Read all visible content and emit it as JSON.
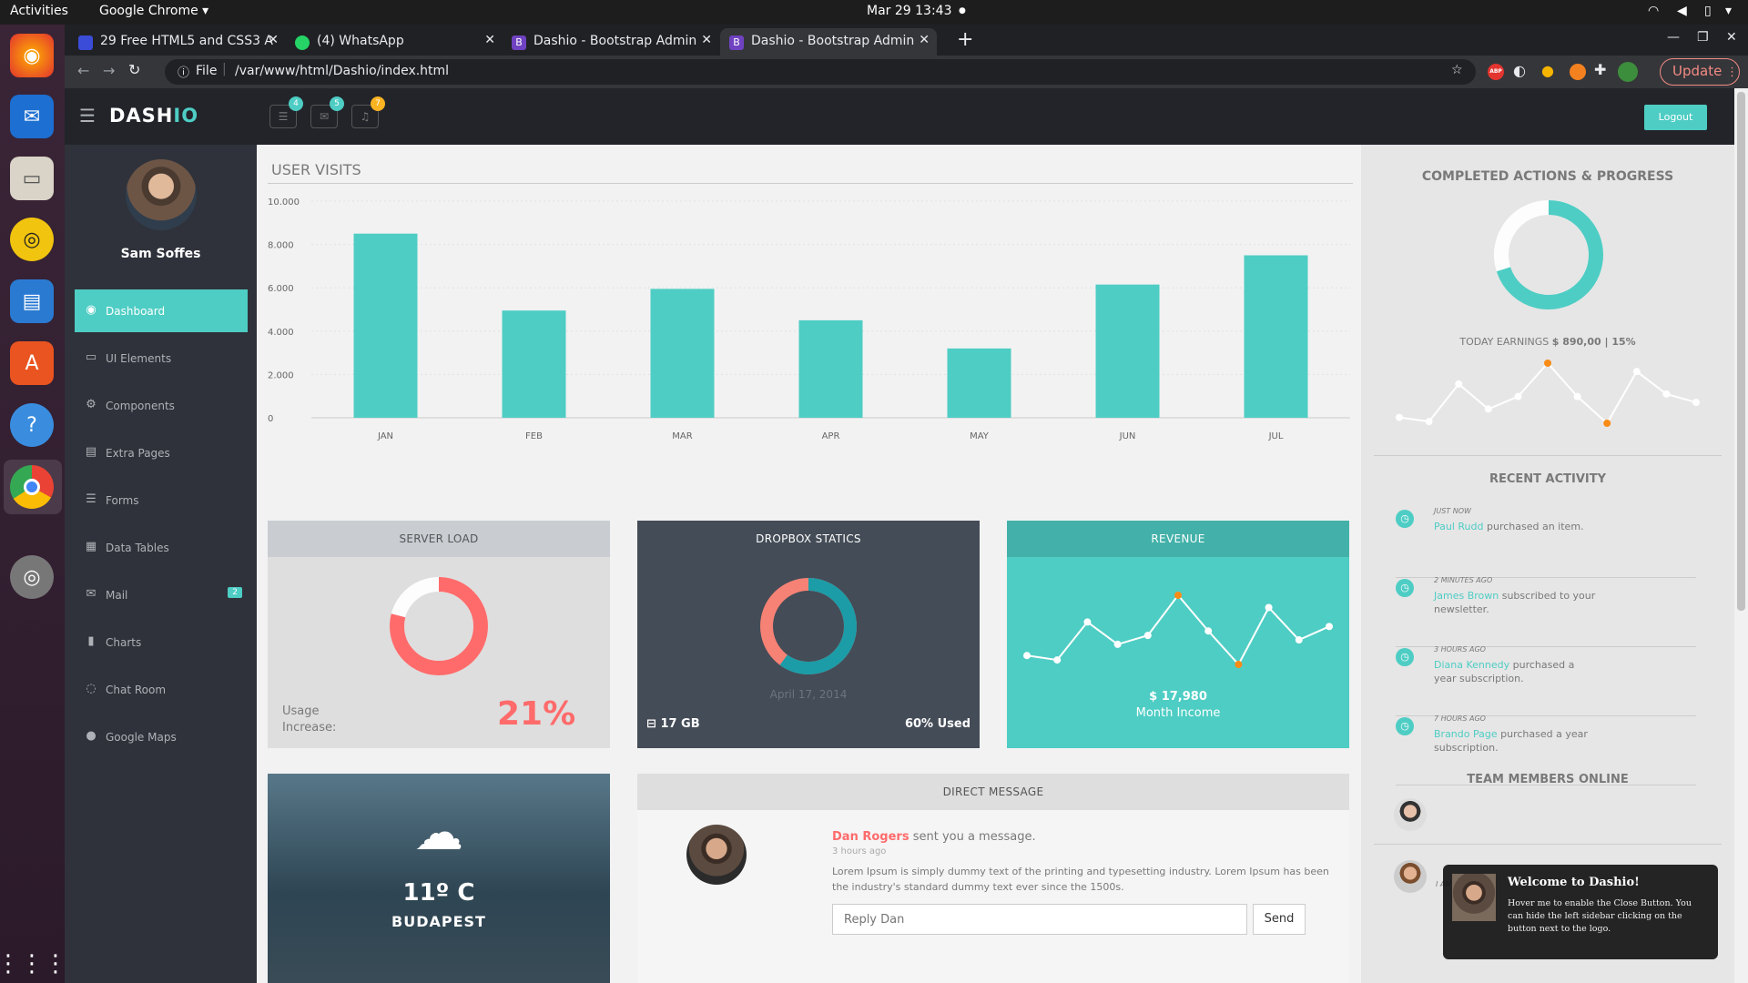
{
  "os": {
    "activities": "Activities",
    "app_menu": "Google Chrome",
    "clock": "Mar 29  13:43"
  },
  "browser": {
    "tabs": [
      {
        "title": "29 Free HTML5 and CSS3 A",
        "color": "#3b4cd9"
      },
      {
        "title": "(4) WhatsApp",
        "color": "#25d366"
      },
      {
        "title": "Dashio - Bootstrap Admin",
        "color": "#6f42c1"
      },
      {
        "title": "Dashio - Bootstrap Admin",
        "color": "#6f42c1"
      }
    ],
    "url_scheme": "File",
    "url": "/var/www/html/Dashio/index.html",
    "update_label": "Update",
    "abp_label": "ABP"
  },
  "app": {
    "logo_a": "DASH",
    "logo_b": "IO",
    "badges": [
      "4",
      "5",
      "7"
    ],
    "logout": "Logout",
    "accent": "#4ecdc4"
  },
  "sidebar": {
    "user_name": "Sam Soffes",
    "items": [
      {
        "label": "Dashboard",
        "icon": "dashboard-icon",
        "glyph": "◉"
      },
      {
        "label": "UI Elements",
        "icon": "desktop-icon",
        "glyph": "▭"
      },
      {
        "label": "Components",
        "icon": "cogs-icon",
        "glyph": "⚙"
      },
      {
        "label": "Extra Pages",
        "icon": "book-icon",
        "glyph": "▤"
      },
      {
        "label": "Forms",
        "icon": "tasks-icon",
        "glyph": "☰"
      },
      {
        "label": "Data Tables",
        "icon": "th-icon",
        "glyph": "▦"
      },
      {
        "label": "Mail",
        "icon": "envelope-icon",
        "glyph": "✉",
        "badge": "2"
      },
      {
        "label": "Charts",
        "icon": "bar-chart-icon",
        "glyph": "▮"
      },
      {
        "label": "Chat Room",
        "icon": "comments-icon",
        "glyph": "◌"
      },
      {
        "label": "Google Maps",
        "icon": "map-marker-icon",
        "glyph": "●"
      }
    ]
  },
  "user_visits": {
    "title": "USER VISITS"
  },
  "chart_data": {
    "type": "bar",
    "title": "USER VISITS",
    "categories": [
      "JAN",
      "FEB",
      "MAR",
      "APR",
      "MAY",
      "JUN",
      "JUL"
    ],
    "values": [
      8500,
      4950,
      5950,
      4500,
      3200,
      6150,
      7500
    ],
    "yticks": [
      "10.000",
      "8.000",
      "6.000",
      "4.000",
      "2.000",
      "0"
    ],
    "ylim": [
      0,
      10000
    ],
    "color": "#4ecdc4",
    "grid": true
  },
  "server_load": {
    "title": "SERVER LOAD",
    "label": "Usage Increase:",
    "label_line1": "Usage",
    "label_line2": "Increase:",
    "value": "21%",
    "percent": 21,
    "color": "#ff6b6b"
  },
  "dropbox": {
    "title": "DROPBOX STATICS",
    "date": "April 17, 2014",
    "size": "17 GB",
    "used": "60% Used",
    "percent": 60
  },
  "revenue": {
    "title": "REVENUE",
    "amount": "$ 17,980",
    "subtitle": "Month Income",
    "series": [
      2,
      1.6,
      5,
      3,
      3.8,
      7.4,
      4.2,
      1.2,
      6.3,
      3.4,
      4.6
    ]
  },
  "weather": {
    "temp": "11º C",
    "city": "BUDAPEST"
  },
  "direct_message": {
    "title": "DIRECT MESSAGE",
    "sender": "Dan Rogers",
    "action": "sent you a message.",
    "time": "3 hours ago",
    "body": "Lorem Ipsum is simply dummy text of the printing and typesetting industry. Lorem Ipsum has been the industry's standard dummy text ever since the 1500s.",
    "placeholder": "Reply Dan",
    "send": "Send"
  },
  "right_panel": {
    "progress_title": "COMPLETED ACTIONS & PROGRESS",
    "progress_percent": 70,
    "earnings_label": "TODAY EARNINGS",
    "earnings_value": "$ 890,00 | 15%",
    "sparkline": [
      2,
      1.5,
      6,
      3,
      4.5,
      8.5,
      4.5,
      1.3,
      7.5,
      4.8,
      3.8
    ],
    "recent_title": "RECENT ACTIVITY",
    "activities": [
      {
        "time": "JUST NOW",
        "who": "Paul Rudd",
        "what": "purchased an item."
      },
      {
        "time": "2 MINUTES AGO",
        "who": "James Brown",
        "what": "subscribed to your newsletter."
      },
      {
        "time": "3 HOURS AGO",
        "who": "Diana Kennedy",
        "what": "purchased a year subscription."
      },
      {
        "time": "7 HOURS AGO",
        "who": "Brando Page",
        "what": "purchased a year subscription."
      }
    ],
    "team_title": "TEAM MEMBERS ONLINE",
    "team_status": "I AM BUSY"
  },
  "toast": {
    "title": "Welcome to Dashio!",
    "body": "Hover me to enable the Close Button. You can hide the left sidebar clicking on the button next to the logo."
  }
}
